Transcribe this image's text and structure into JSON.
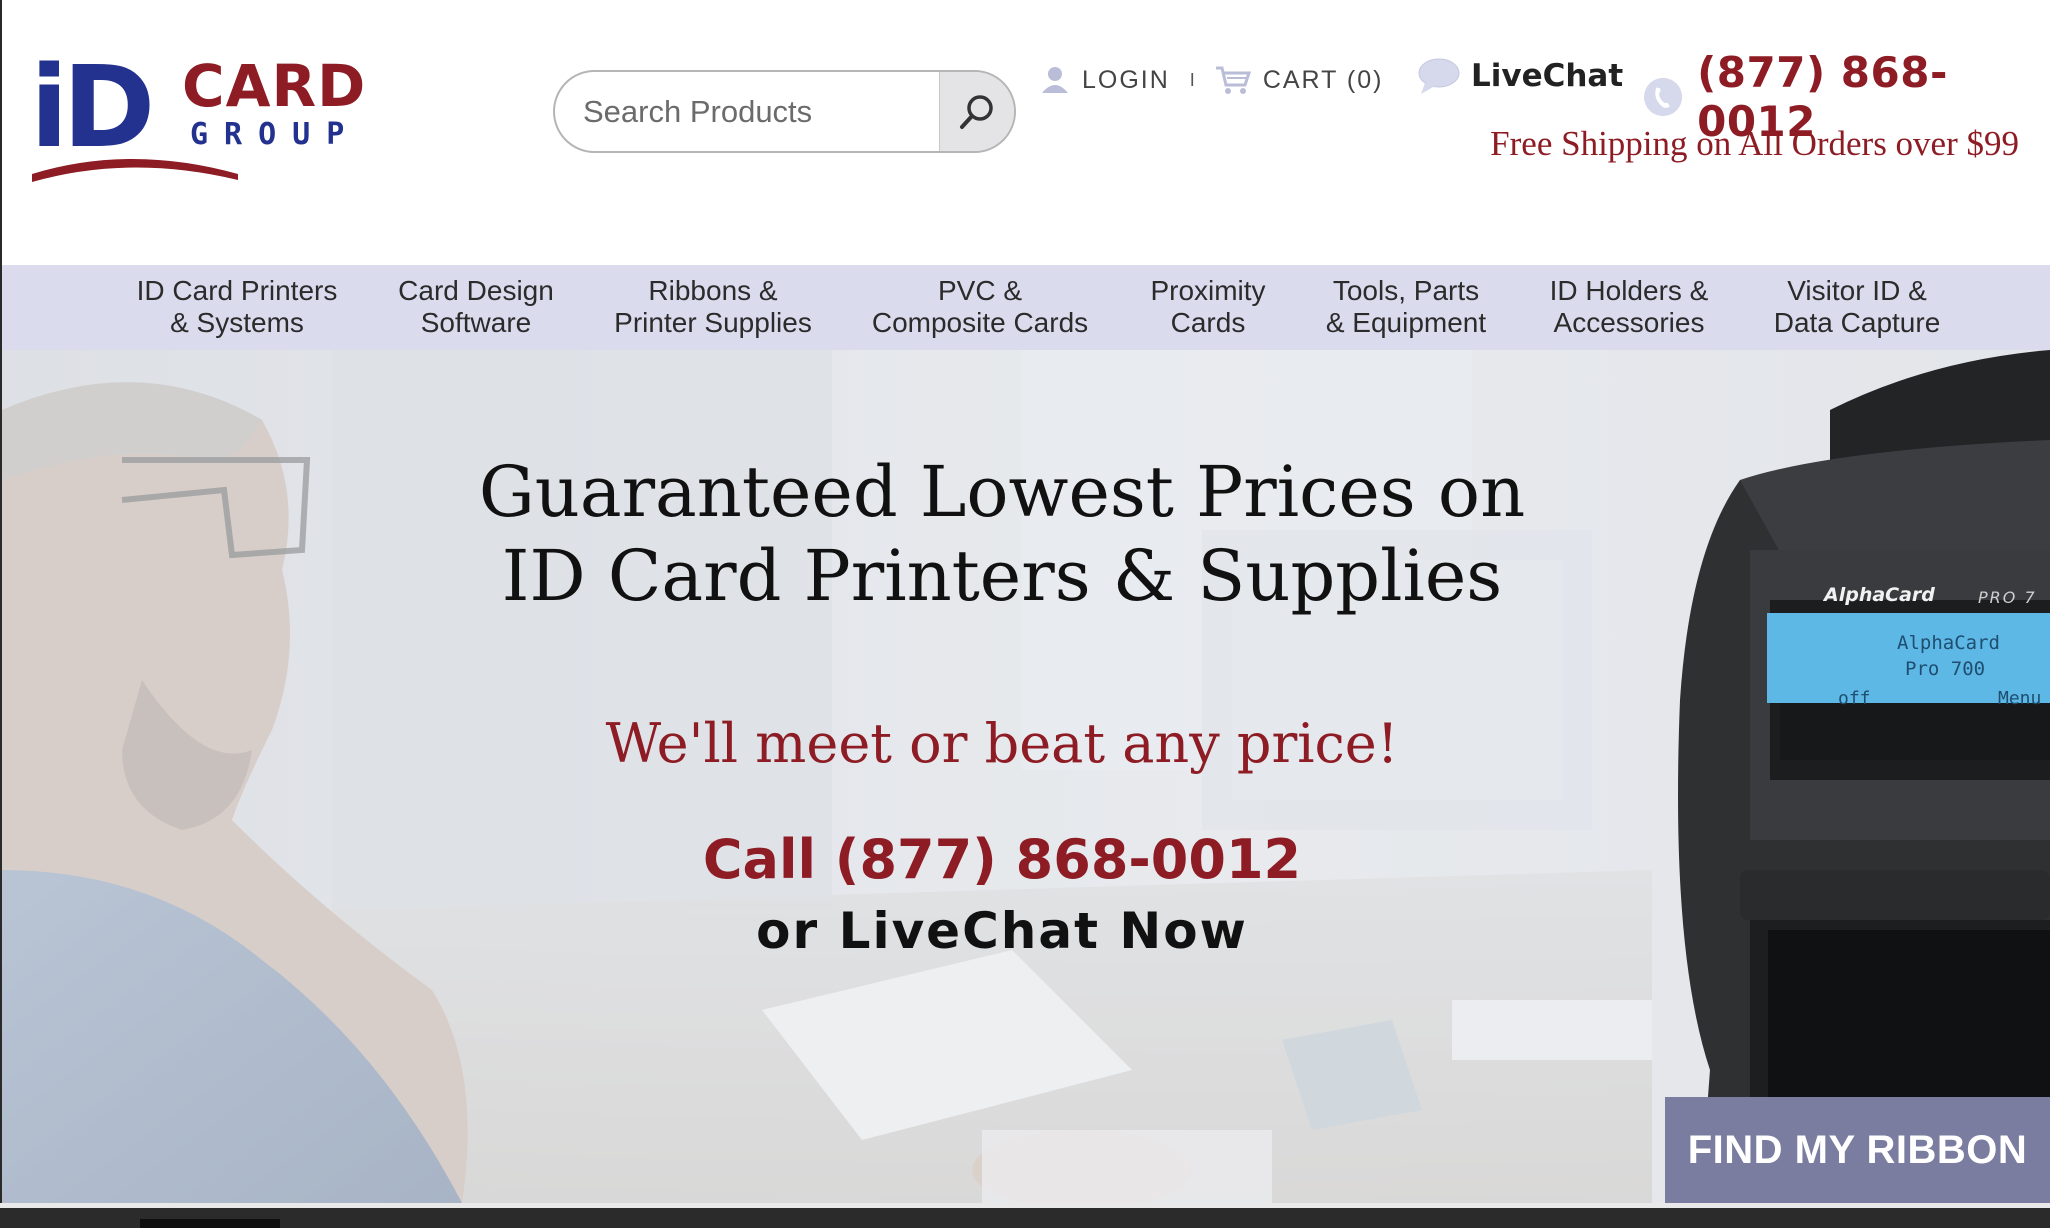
{
  "brand": {
    "logo_id_text": "iD",
    "logo_card_text": "CARD",
    "logo_group_text": "GROUP",
    "colors": {
      "navy": "#23318f",
      "maroon": "#8e1c24"
    }
  },
  "search": {
    "placeholder": "Search Products",
    "value": "",
    "icon": "search-icon"
  },
  "header": {
    "login_label": "LOGIN",
    "separator": "I",
    "cart_label": "CART (0)",
    "livechat_label": "LiveChat",
    "phone": "(877) 868-0012",
    "shipping_note": "Free Shipping on All Orders over $99"
  },
  "nav": {
    "items": [
      {
        "line1": "ID Card Printers",
        "line2": "& Systems"
      },
      {
        "line1": "Card Design",
        "line2": "Software"
      },
      {
        "line1": "Ribbons &",
        "line2": "Printer Supplies"
      },
      {
        "line1": "PVC &",
        "line2": "Composite Cards"
      },
      {
        "line1": "Proximity",
        "line2": "Cards"
      },
      {
        "line1": "Tools, Parts",
        "line2": "& Equipment"
      },
      {
        "line1": "ID Holders &",
        "line2": "Accessories"
      },
      {
        "line1": "Visitor ID &",
        "line2": "Data Capture"
      }
    ]
  },
  "hero": {
    "headline_line1": "Guaranteed Lowest Prices on",
    "headline_line2": "ID Card Printers & Supplies",
    "subheadline": "We'll meet or beat any price!",
    "call_text": "Call (877) 868-0012",
    "chat_text": "or LiveChat Now",
    "printer_brand": "AlphaCard",
    "printer_model": "PRO 7",
    "lcd_line1": "AlphaCard",
    "lcd_line2": "Pro 700",
    "lcd_left": "off",
    "lcd_right": "Menu",
    "ribbon_button": "FIND MY RIBBON"
  }
}
